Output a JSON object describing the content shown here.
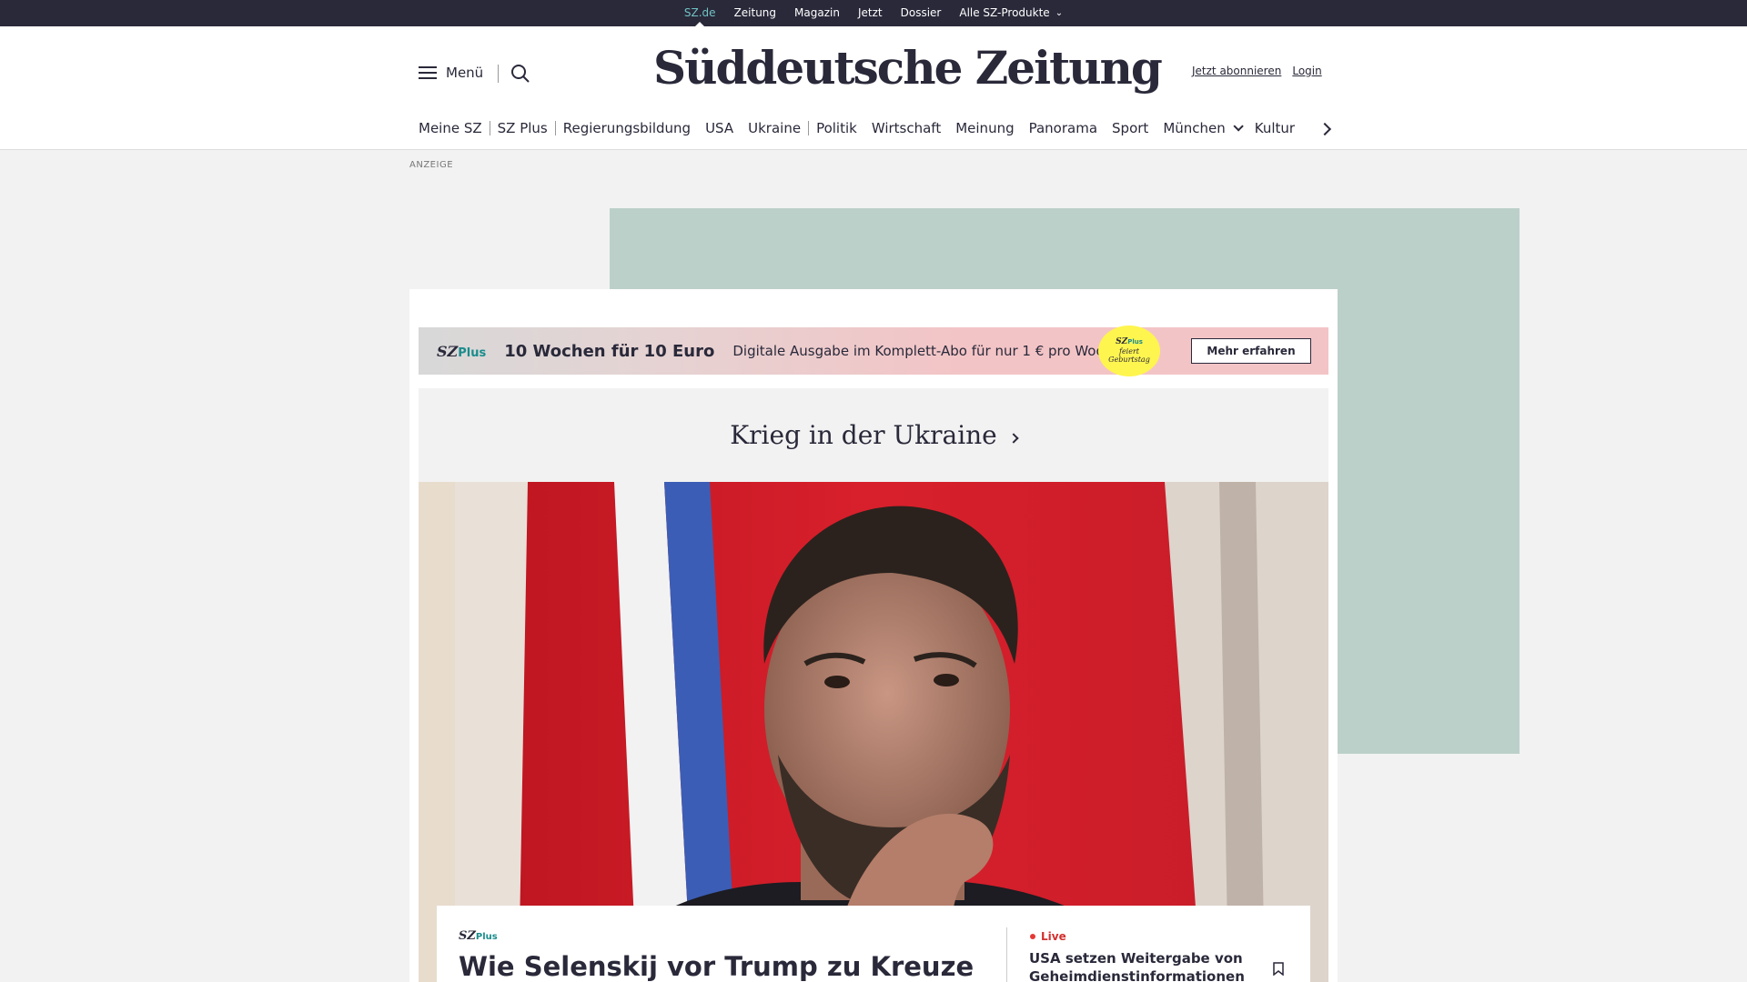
{
  "topbar": {
    "items": [
      "SZ.de",
      "Zeitung",
      "Magazin",
      "Jetzt",
      "Dossier",
      "Alle SZ-Produkte"
    ]
  },
  "header": {
    "menu_label": "Menü",
    "logo": "Süddeutsche Zeitung",
    "subscribe": "Jetzt abonnieren",
    "login": "Login"
  },
  "nav": {
    "items": [
      "Meine SZ",
      "SZ Plus",
      "Regierungsbildung",
      "USA",
      "Ukraine",
      "Politik",
      "Wirtschaft",
      "Meinung",
      "Panorama",
      "Sport",
      "München",
      "Kultur"
    ]
  },
  "ad": {
    "label": "ANZEIGE"
  },
  "promo": {
    "logo_sz": "SZ",
    "logo_plus": "Plus",
    "title": "10 Wochen für 10 Euro",
    "text": "Digitale Ausgabe im Komplett-Abo für nur 1 € pro Woche.",
    "badge_sz": "SZ",
    "badge_plus": "Plus",
    "badge_line2": "feiert",
    "badge_line3": "Geburtstag",
    "button": "Mehr erfahren"
  },
  "section": {
    "title": "Krieg in der Ukraine"
  },
  "card": {
    "logo_sz": "SZ",
    "logo_plus": "Plus",
    "headline": "Wie Selenskij vor Trump zu Kreuze",
    "live_label": "Live",
    "live_text": "USA setzen Weitergabe von Geheimdienstinformationen an"
  },
  "colors": {
    "topbar_bg": "#29293a",
    "accent_teal": "#71c3c3",
    "ad_bg": "#bcd0ca",
    "live_red": "#d32f2f",
    "badge_yellow": "#fff54f"
  }
}
